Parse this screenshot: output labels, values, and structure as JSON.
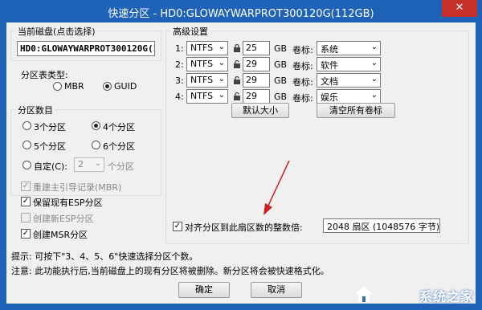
{
  "window": {
    "title": "快速分区 - HD0:GLOWAYWARPROT300120G(112GB)",
    "close_label": "✕"
  },
  "disk": {
    "label": "当前磁盘(点击选择)",
    "value": "HD0:GLOWAYWARPROT300120G(11"
  },
  "partition_type": {
    "label": "分区表类型:",
    "options": [
      "MBR",
      "GUID"
    ],
    "selected": "GUID"
  },
  "partition_count": {
    "label": "分区数目",
    "options": [
      "3个分区",
      "4个分区",
      "5个分区",
      "6个分区"
    ],
    "selected": "4个分区",
    "custom_label": "自定(C):",
    "custom_value": "2",
    "custom_suffix": "个分区"
  },
  "options": {
    "rebuild_mbr": "重建主引导记录(MBR)",
    "keep_esp": "保留现有ESP分区",
    "create_esp": "创建新ESP分区",
    "create_msr": "创建MSR分区"
  },
  "advanced": {
    "label": "高级设置",
    "size_unit": "GB",
    "volume_label_caption": "卷标:",
    "rows": [
      {
        "index": "1:",
        "fs": "NTFS",
        "size": "25",
        "volume": "系统"
      },
      {
        "index": "2:",
        "fs": "NTFS",
        "size": "29",
        "volume": "软件"
      },
      {
        "index": "3:",
        "fs": "NTFS",
        "size": "29",
        "volume": "文档"
      },
      {
        "index": "4:",
        "fs": "NTFS",
        "size": "29",
        "volume": "娱乐"
      }
    ],
    "default_size_btn": "默认大小",
    "clear_labels_btn": "清空所有卷标"
  },
  "align": {
    "label": "对齐分区到此扇区数的整数倍:",
    "value": "2048 扇区 (1048576 字节)"
  },
  "tips": {
    "line1": "提示: 可按下\"3、4、5、6\"快速选择分区个数。",
    "line2": "注意: 此功能执行后,当前磁盘上的现有分区将被删除。新分区将会被快速格式化。"
  },
  "buttons": {
    "ok": "确定",
    "cancel": "取消"
  },
  "watermark": {
    "text": "系统之家"
  },
  "colors": {
    "titlebar": "#1e63b7",
    "close": "#c7302b",
    "annotation_arrow": "#cc1f1f"
  }
}
